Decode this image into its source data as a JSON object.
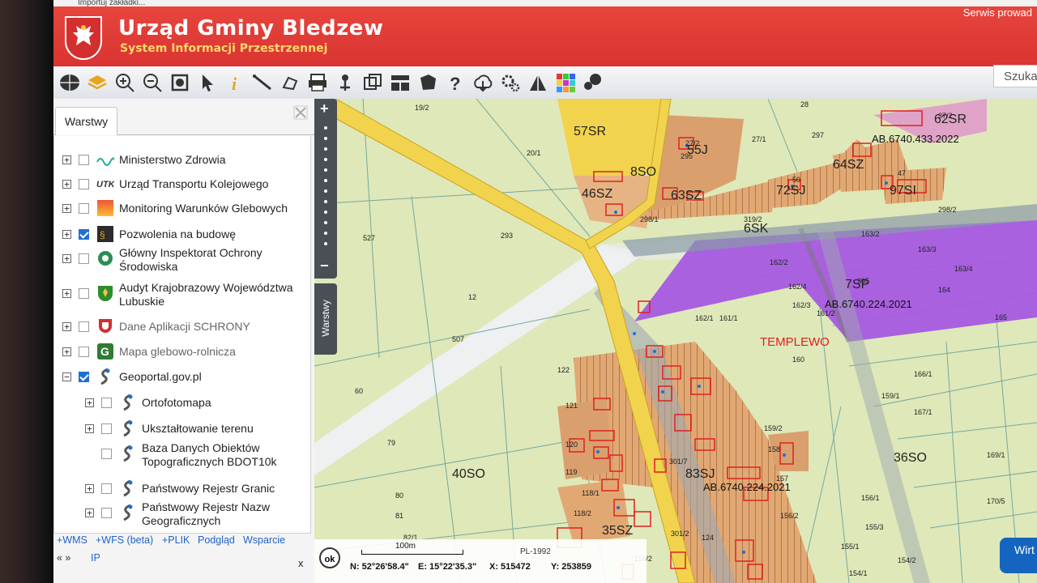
{
  "browser": {
    "bookmark_text": "Importuj zakładki..."
  },
  "header": {
    "title": "Urząd Gminy Bledzew",
    "subtitle": "System Informacji Przestrzennej",
    "service_link": "Serwis prowad",
    "search_placeholder": "Szuka"
  },
  "toolbar": {
    "tools": [
      "globe-icon",
      "layers-icon",
      "zoom-in-icon",
      "zoom-out-icon",
      "zoom-extent-icon",
      "pointer-icon",
      "info-icon",
      "measure-distance-icon",
      "measure-area-icon",
      "print-icon",
      "coordinates-icon",
      "export-icon",
      "layout-icon",
      "parcel-icon",
      "help-icon",
      "cloud-download-icon",
      "settings-icon",
      "terrain-icon",
      "grid-icon",
      "chat-icon"
    ]
  },
  "sidebar": {
    "tab_label": "Warstwy",
    "layers": [
      {
        "label": "Ministerstwo Zdrowia",
        "checked": false,
        "expandable": true,
        "icon": "wave-icon",
        "dim": false
      },
      {
        "label": "Urząd Transportu Kolejowego",
        "checked": false,
        "expandable": true,
        "icon": "utk-icon",
        "dim": false
      },
      {
        "label": "Monitoring Warunków Glebowych",
        "checked": false,
        "expandable": true,
        "icon": "gradient-icon",
        "dim": false
      },
      {
        "label": "Pozwolenia na budowę",
        "checked": true,
        "expandable": true,
        "icon": "building-permit-icon",
        "dim": false
      },
      {
        "label_lines": [
          "Główny Inspektorat Ochrony",
          "Środowiska"
        ],
        "checked": false,
        "expandable": true,
        "icon": "gios-icon",
        "dim": false
      },
      {
        "label_lines": [
          "Audyt Krajobrazowy Województwa",
          "Lubuskie"
        ],
        "checked": false,
        "expandable": true,
        "icon": "lubuskie-crest-icon",
        "dim": false
      },
      {
        "label": "Dane Aplikacji SCHRONY",
        "checked": false,
        "expandable": true,
        "icon": "shield-icon",
        "dim": true
      },
      {
        "label": "Mapa glebowo-rolnicza",
        "checked": false,
        "expandable": true,
        "icon": "g-logo-icon",
        "dim": true
      },
      {
        "label": "Geoportal.gov.pl",
        "checked": true,
        "expandable": true,
        "expanded": true,
        "icon": "geoportal-icon",
        "dim": false
      },
      {
        "label": "Ortofotomapa",
        "checked": false,
        "expandable": true,
        "icon": "geoportal-icon",
        "dim": false
      },
      {
        "label": "Ukształtowanie terenu",
        "checked": false,
        "expandable": true,
        "icon": "geoportal-icon",
        "dim": false
      },
      {
        "label_lines": [
          "Baza Danych Obiektów",
          "Topograficznych BDOT10k"
        ],
        "checked": false,
        "expandable": false,
        "icon": "geoportal-icon",
        "dim": false
      },
      {
        "label": "Państwowy Rejestr Granic",
        "checked": false,
        "expandable": true,
        "icon": "geoportal-icon",
        "dim": false
      },
      {
        "label_lines": [
          "Państwowy Rejestr Nazw",
          "Geograficznych"
        ],
        "checked": false,
        "expandable": true,
        "icon": "geoportal-icon",
        "dim": false
      }
    ],
    "footer": {
      "add_wms": "+WMS",
      "add_wfs": "+WFS (beta)",
      "add_file": "+PLIK",
      "preview": "Podgląd",
      "support": "Wsparcie",
      "nav": "«  »",
      "ip": "IP",
      "close": "x"
    }
  },
  "map_controls": {
    "zoom_in": "+",
    "zoom_out": "−",
    "layers_tab": "Warstwy"
  },
  "map": {
    "labels": {
      "place": "TEMPLEWO",
      "zones": [
        "57SR",
        "8SO",
        "46SZ",
        "63SZ",
        "72SJ",
        "64SZ",
        "97SI",
        "6SK",
        "7SP",
        "40SO",
        "36SO",
        "83SJ",
        "35SZ",
        "62SR",
        "55J"
      ],
      "permits": [
        "AB.6740.433.2022",
        "AB.6740.224.2021",
        "AB.6740.224.2021"
      ],
      "parcels": [
        "19/2",
        "28",
        "37/2",
        "27/1",
        "27/2",
        "297",
        "295",
        "20/1",
        "298/1",
        "298/2",
        "319/2",
        "47",
        "50",
        "527",
        "293",
        "163/2",
        "163/3",
        "163/4",
        "162/2",
        "162/4",
        "162/3",
        "162/1",
        "161/2",
        "161/1",
        "305",
        "164",
        "165",
        "12",
        "507",
        "160",
        "166/1",
        "159/1",
        "167/1",
        "122",
        "121",
        "120",
        "119",
        "118/1",
        "118/2",
        "60",
        "79",
        "80",
        "81",
        "82/1",
        "157",
        "156/1",
        "155/3",
        "156/2",
        "155/1",
        "159/2",
        "158",
        "154/2",
        "154/1",
        "169/1",
        "170/5",
        "301/2",
        "124",
        "116/2",
        "301/7"
      ]
    },
    "scale_label": "100m",
    "projection": "PL-1992",
    "ok_button": "ok",
    "coords": {
      "n": "N: 52°26'58.4\"",
      "e": "E: 15°22'35.3\"",
      "x": "X: 515472",
      "y": "Y: 253859"
    }
  },
  "right_button": "Wirt",
  "colors": {
    "banner": "#de3b37",
    "subtitle": "#ffd76a",
    "link": "#2263c9",
    "zone_purple": "#a55ae0",
    "zone_yellow": "#f2d34d",
    "zone_brown": "#d9a06d",
    "parcel_bg": "#dfe8b9"
  }
}
